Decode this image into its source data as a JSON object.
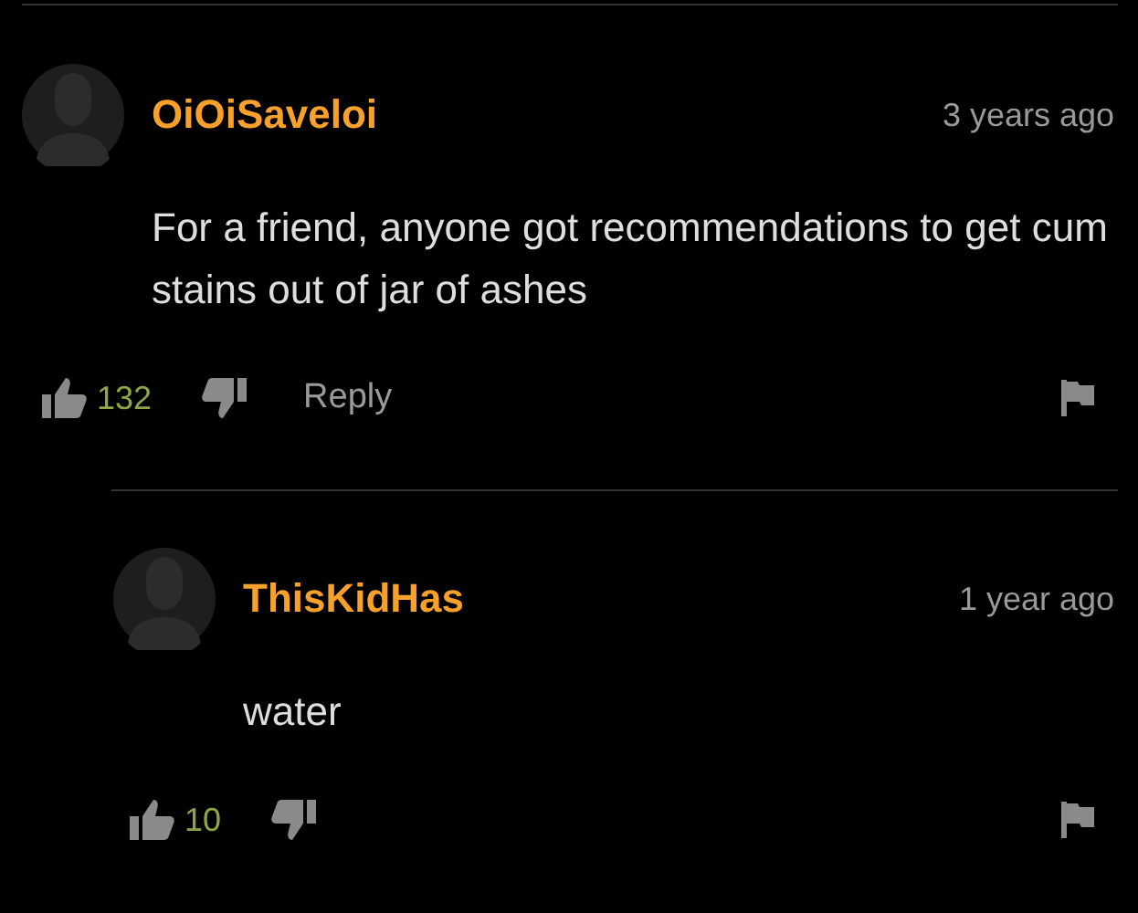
{
  "comments": [
    {
      "username": "OiOiSaveloi",
      "time": "3 years ago",
      "text": "For a friend, anyone got recommendations to get cum stains out of jar of ashes",
      "likes": "132",
      "reply_label": "Reply",
      "replies": [
        {
          "username": "ThisKidHas",
          "time": "1 year ago",
          "text": "water",
          "likes": "10"
        }
      ]
    }
  ]
}
